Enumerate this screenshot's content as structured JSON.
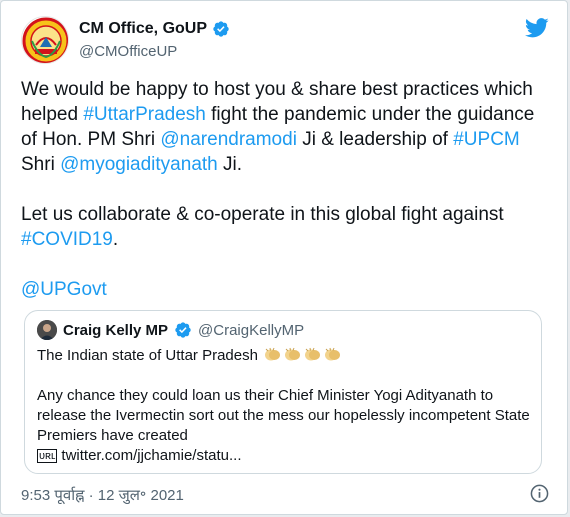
{
  "author": {
    "name": "CM Office, GoUP",
    "handle": "@CMOfficeUP"
  },
  "icons": {
    "brand": "twitter-bird-icon",
    "verified": "verified-badge-icon",
    "info": "info-icon",
    "accent": "#1d9bf0"
  },
  "tweet": {
    "p1": {
      "t1": "We would be happy to host you & share best practices which helped ",
      "tag1": "#UttarPradesh",
      "t2": " fight the pandemic under the guidance of Hon. PM Shri ",
      "mention1": "@narendramodi",
      "t3": " Ji & leadership of ",
      "tag2": "#UPCM",
      "t4": " Shri ",
      "mention2": "@myogiadityanath",
      "t5": " Ji."
    },
    "p2": {
      "t1": "Let us collaborate & co-operate in this global fight against ",
      "tag1": "#COVID19",
      "t2": "."
    },
    "p3": {
      "mention": "@UPGovt"
    }
  },
  "quoted": {
    "name": "Craig Kelly MP",
    "handle": "@CraigKellyMP",
    "line1": "The Indian state of Uttar Pradesh",
    "line2": "Any chance they could loan us their Chief Minister Yogi Adityanath to release the Ivermectin sort out the mess our hopelessly incompetent State Premiers have created",
    "link_prefix": "ᴜʀʟ",
    "link": "twitter.com/jjchamie/statu..."
  },
  "footer": {
    "timestamp": "9:53 पूर्वाह्न · 12 जुल॰ 2021"
  }
}
